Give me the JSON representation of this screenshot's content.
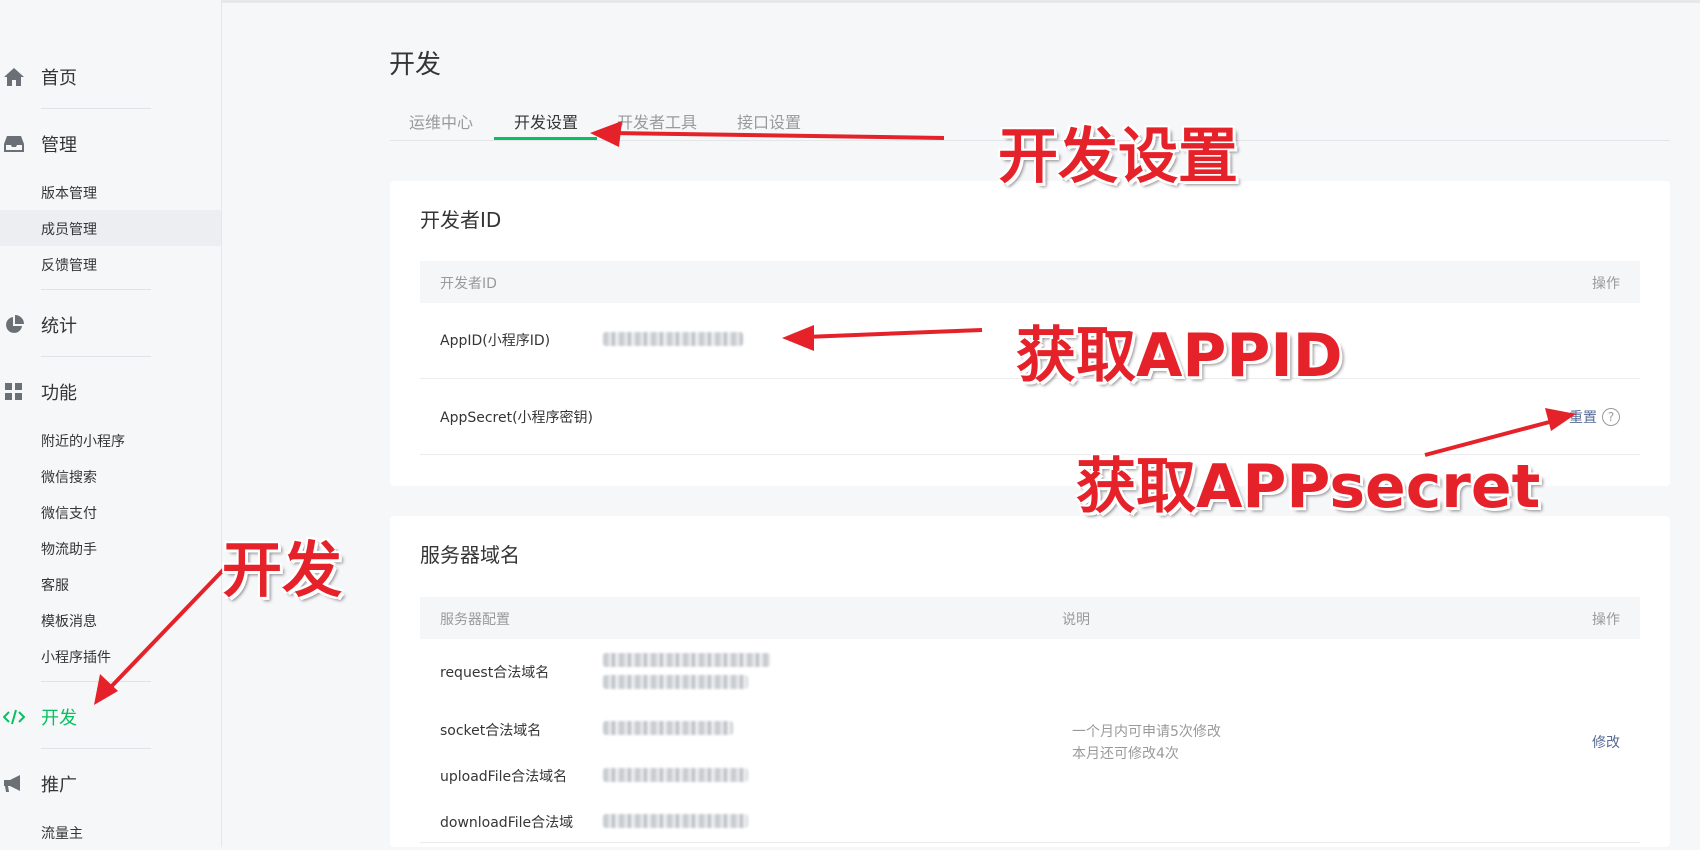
{
  "sidebar": {
    "groups": [
      {
        "label": "首页",
        "icon": "home-icon"
      },
      {
        "label": "管理",
        "icon": "inbox-icon"
      },
      {
        "label": "统计",
        "icon": "pie-chart-icon"
      },
      {
        "label": "功能",
        "icon": "grid-icon"
      },
      {
        "label": "开发",
        "icon": "code-icon"
      },
      {
        "label": "推广",
        "icon": "megaphone-icon"
      }
    ],
    "manage_items": [
      "版本管理",
      "成员管理",
      "反馈管理"
    ],
    "feature_items": [
      "附近的小程序",
      "微信搜索",
      "微信支付",
      "物流助手",
      "客服",
      "模板消息",
      "小程序插件"
    ],
    "promo_items": [
      "流量主"
    ]
  },
  "page": {
    "title": "开发"
  },
  "tabs": [
    "运维中心",
    "开发设置",
    "开发者工具",
    "接口设置"
  ],
  "dev_id_card": {
    "title": "开发者ID",
    "col_id": "开发者ID",
    "col_action": "操作",
    "appid_label": "AppID(小程序ID)",
    "secret_label": "AppSecret(小程序密钥)",
    "reset_label": "重置",
    "help_glyph": "?"
  },
  "server_card": {
    "title": "服务器域名",
    "col_config": "服务器配置",
    "col_desc": "说明",
    "col_action": "操作",
    "rows": [
      "request合法域名",
      "socket合法域名",
      "uploadFile合法域名",
      "downloadFile合法域"
    ],
    "note_1": "一个月内可申请5次修改",
    "note_2": "本月还可修改4次",
    "modify_label": "修改"
  },
  "annotations": {
    "dev_settings": "开发设置",
    "get_appid": "获取APPID",
    "get_secret": "获取APPsecret",
    "dev": "开发"
  },
  "colors": {
    "accent": "#07c160",
    "link": "#576b95",
    "annotation": "#e52229"
  }
}
